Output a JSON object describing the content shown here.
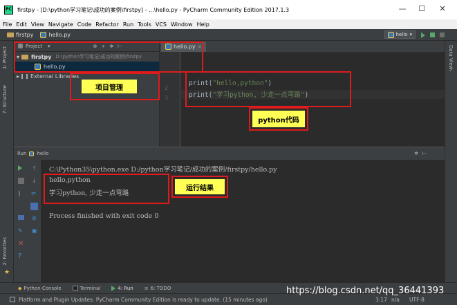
{
  "window": {
    "title": "firstpy - [D:\\python学习笔记\\成功的案例\\firstpy] - ...\\hello.py - PyCharm Community Edition 2017.1.3",
    "minimize": "—",
    "maximize": "☐",
    "close": "✕"
  },
  "menu": [
    "File",
    "Edit",
    "View",
    "Navigate",
    "Code",
    "Refactor",
    "Run",
    "Tools",
    "VCS",
    "Window",
    "Help"
  ],
  "navbar": {
    "project": "firstpy",
    "file": "hello.py",
    "run_config": "hello"
  },
  "project_panel": {
    "title": "Project",
    "root_name": "firstpy",
    "root_path": "D:\\python学习笔记\\成功的案例\\firstpy",
    "file": "hello.py",
    "external": "External Libraries"
  },
  "editor": {
    "tab": "hello.py",
    "lines": [
      {
        "num": "2",
        "code": "print(",
        "str": "\"hello,python\"",
        "end": ")"
      },
      {
        "num": "3",
        "code": "print(",
        "str": "\"学习python, 少走一点弯路\"",
        "end": ")"
      }
    ]
  },
  "run": {
    "tab_label": "Run",
    "config": "hello",
    "command": "C:\\Python35\\python.exe D:/python学习笔记/成功的案例/firstpy/hello.py",
    "output1": "hello,python",
    "output2": "学习python, 少走一点弯路",
    "exit": "Process finished with exit code 0"
  },
  "left_tabs": {
    "project": "1: Project",
    "structure": "7: Structure",
    "favorites": "2: Favorites"
  },
  "right_tabs": {
    "data_view": "Data View"
  },
  "bottom_tabs": [
    "Python Console",
    "Terminal",
    "4: Run",
    "6: TODO"
  ],
  "status": {
    "message": "Platform and Plugin Updates: PyCharm Community Edition is ready to update. (15 minutes ago)",
    "pos": "3:17",
    "crlf": "n/a",
    "encoding": "UTF-8"
  },
  "annotations": {
    "project_mgmt": "项目管理",
    "python_code": "python代码",
    "run_result": "运行结果"
  },
  "watermark": "https://blog.csdn.net/qq_36441393",
  "colors": {
    "annotation_box": "#e01b1b",
    "annotation_label": "#ffff55",
    "string": "#6a8759",
    "keyword": "#a9b7c6"
  }
}
